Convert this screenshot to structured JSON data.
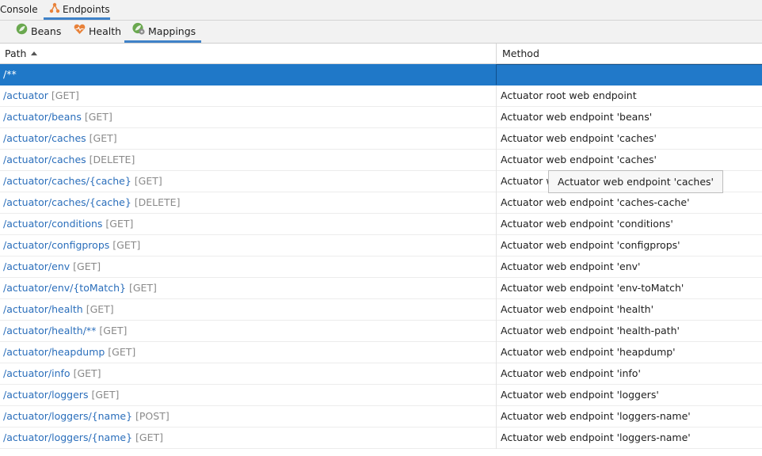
{
  "tool_window": {
    "tabs": [
      {
        "label": "Console",
        "icon": "none"
      },
      {
        "label": "Endpoints",
        "icon": "endpoints-icon",
        "active": true
      }
    ]
  },
  "sub_tabs": [
    {
      "label": "Beans",
      "icon": "spring-bean-icon"
    },
    {
      "label": "Health",
      "icon": "heart-icon"
    },
    {
      "label": "Mappings",
      "icon": "spring-mappings-icon",
      "active": true
    }
  ],
  "table": {
    "headers": {
      "path": "Path",
      "method": "Method"
    },
    "sort": "path-ascending",
    "selected_row": {
      "path": "/**",
      "method": ""
    },
    "rows": [
      {
        "path": "/actuator",
        "verb": "[GET]",
        "method": "Actuator root web endpoint"
      },
      {
        "path": "/actuator/beans",
        "verb": "[GET]",
        "method": "Actuator web endpoint 'beans'"
      },
      {
        "path": "/actuator/caches",
        "verb": "[GET]",
        "method": "Actuator web endpoint 'caches'"
      },
      {
        "path": "/actuator/caches",
        "verb": "[DELETE]",
        "method": "Actuator web endpoint 'caches'"
      },
      {
        "path": "/actuator/caches/{cache}",
        "verb": "[GET]",
        "method": "Actuator w"
      },
      {
        "path": "/actuator/caches/{cache}",
        "verb": "[DELETE]",
        "method": "Actuator web endpoint 'caches-cache'"
      },
      {
        "path": "/actuator/conditions",
        "verb": "[GET]",
        "method": "Actuator web endpoint 'conditions'"
      },
      {
        "path": "/actuator/configprops",
        "verb": "[GET]",
        "method": "Actuator web endpoint 'configprops'"
      },
      {
        "path": "/actuator/env",
        "verb": "[GET]",
        "method": "Actuator web endpoint 'env'"
      },
      {
        "path": "/actuator/env/{toMatch}",
        "verb": "[GET]",
        "method": "Actuator web endpoint 'env-toMatch'"
      },
      {
        "path": "/actuator/health",
        "verb": "[GET]",
        "method": "Actuator web endpoint 'health'"
      },
      {
        "path": "/actuator/health/**",
        "verb": "[GET]",
        "method": "Actuator web endpoint 'health-path'"
      },
      {
        "path": "/actuator/heapdump",
        "verb": "[GET]",
        "method": "Actuator web endpoint 'heapdump'"
      },
      {
        "path": "/actuator/info",
        "verb": "[GET]",
        "method": "Actuator web endpoint 'info'"
      },
      {
        "path": "/actuator/loggers",
        "verb": "[GET]",
        "method": "Actuator web endpoint 'loggers'"
      },
      {
        "path": "/actuator/loggers/{name}",
        "verb": "[POST]",
        "method": "Actuator web endpoint 'loggers-name'"
      },
      {
        "path": "/actuator/loggers/{name}",
        "verb": "[GET]",
        "method": "Actuator web endpoint 'loggers-name'"
      }
    ]
  },
  "tooltip": {
    "text": "Actuator web endpoint 'caches'"
  },
  "colors": {
    "accent": "#3f82c8",
    "selection": "#1f78c8",
    "path_link": "#2a6ebb",
    "verb": "#8a8a8a"
  }
}
